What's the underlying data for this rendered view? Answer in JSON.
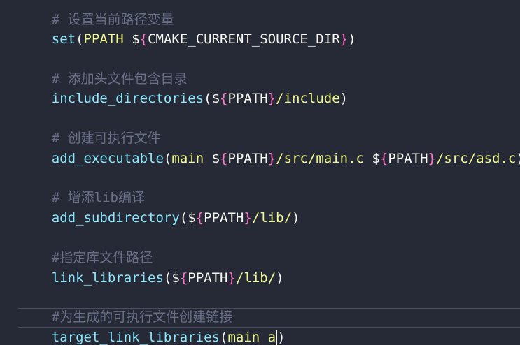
{
  "lines": {
    "l0": {
      "text": "# 设置当前路径变量"
    },
    "l1": {
      "fn": "set",
      "open": "(",
      "var": "PPATH ",
      "d1": "$",
      "b1": "{",
      "arg": "CMAKE_CURRENT_SOURCE_DIR",
      "b2": "}",
      "close": ")"
    },
    "l2": {
      "text": "# 添加头文件包含目录"
    },
    "l3": {
      "fn": "include_directories",
      "open": "(",
      "d1": "$",
      "b1": "{",
      "arg": "PPATH",
      "b2": "}",
      "path": "/include",
      "close": ")"
    },
    "l4": {
      "text": "# 创建可执行文件"
    },
    "l5": {
      "fn": "add_executable",
      "open": "(",
      "var": "main ",
      "d1": "$",
      "b1": "{",
      "arg": "PPATH",
      "b2": "}",
      "path": "/src/main.c ",
      "d2": "$",
      "b3": "{",
      "arg2": "PPATH",
      "b4": "}",
      "path2": "/src/asd.c",
      "close": ")"
    },
    "l6": {
      "text": "# 增添lib编译"
    },
    "l7": {
      "fn": "add_subdirectory",
      "open": "(",
      "d1": "$",
      "b1": "{",
      "arg": "PPATH",
      "b2": "}",
      "path": "/lib/",
      "close": ")"
    },
    "l8": {
      "text": "#指定库文件路径"
    },
    "l9": {
      "fn": "link_libraries",
      "open": "(",
      "d1": "$",
      "b1": "{",
      "arg": "PPATH",
      "b2": "}",
      "path": "/lib/",
      "close": ")"
    },
    "l10": {
      "text": "#为生成的可执行文件创建链接"
    },
    "l11": {
      "fn": "target_link_libraries",
      "open": "(",
      "var": "main a",
      "close": ")"
    }
  }
}
